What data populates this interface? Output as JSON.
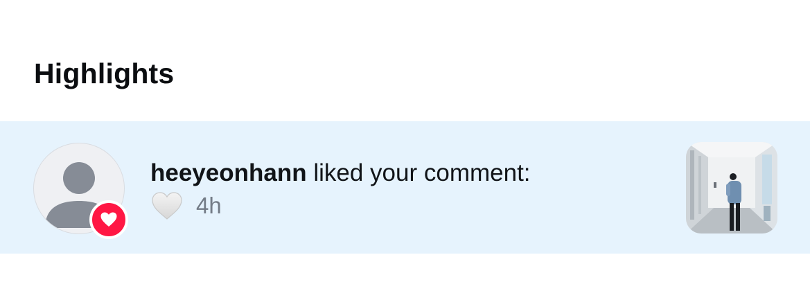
{
  "section": {
    "title": "Highlights"
  },
  "notification": {
    "username": "heeyeonhann",
    "action_text": "liked your comment:",
    "reaction_icon": "white-heart-icon",
    "time": "4h",
    "badge_icon": "heart-icon",
    "colors": {
      "row_background": "#e6f3fd",
      "badge": "#ff1744"
    }
  }
}
